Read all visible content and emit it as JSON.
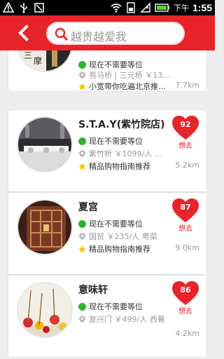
{
  "status_bar": {
    "ampm": "下午",
    "time": "1:55"
  },
  "header": {
    "search_text": "越贵越爱我"
  },
  "colors": {
    "accent": "#e8242a",
    "status_green": "#2fb32f",
    "star": "#f6c400"
  },
  "cards": [
    {
      "title": "",
      "status": "现在不需要等位",
      "location": "亮马桥 | 三元桥 ￥13…",
      "tag": "小宽带你吃遍北京推…",
      "distance": "7.7km",
      "score": "",
      "want": "想去"
    },
    {
      "title": "S.T.A.Y(紫竹院店)",
      "status": "现在不需要等位",
      "location": "紫竹桥 ￥1099/人 …",
      "tag": "精品购物指南推荐",
      "distance": "5.2km",
      "score": "92",
      "want": "想去"
    },
    {
      "title": "夏宫",
      "status": "现在不需要等位",
      "location": "国贸 ￥235/人 粤菜",
      "tag": "精品购物指南推荐",
      "distance": "9.0km",
      "score": "87",
      "want": "想去"
    },
    {
      "title": "意味轩",
      "status": "现在不需要等位",
      "location": "复兴门 ￥499/人 西餐",
      "tag": "",
      "distance": "4.2km",
      "score": "86",
      "want": "想去"
    }
  ]
}
